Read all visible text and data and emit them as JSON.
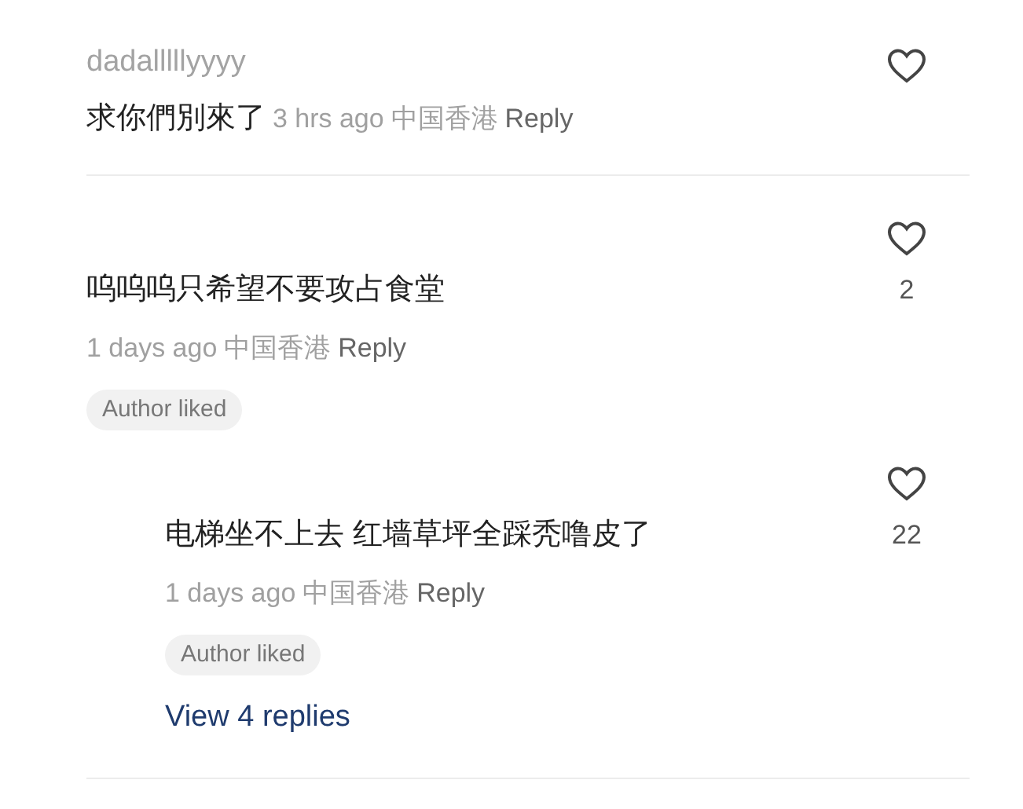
{
  "comments": [
    {
      "kind": "inline",
      "username": "dadalllllyyyy",
      "text": "求你們別來了",
      "time": "3 hrs ago",
      "location": "中国香港",
      "reply": "Reply"
    },
    {
      "kind": "stacked",
      "text": "呜呜呜只希望不要攻占食堂",
      "time": "1 days ago",
      "location": "中国香港",
      "reply": "Reply",
      "likes": "2",
      "badge": "Author liked",
      "children": [
        {
          "kind": "stacked",
          "text": "电梯坐不上去 红墙草坪全踩秃噜皮了",
          "time": "1 days ago",
          "location": "中国香港",
          "reply": "Reply",
          "likes": "22",
          "badge": "Author liked",
          "more": "View 4 replies"
        }
      ]
    }
  ]
}
